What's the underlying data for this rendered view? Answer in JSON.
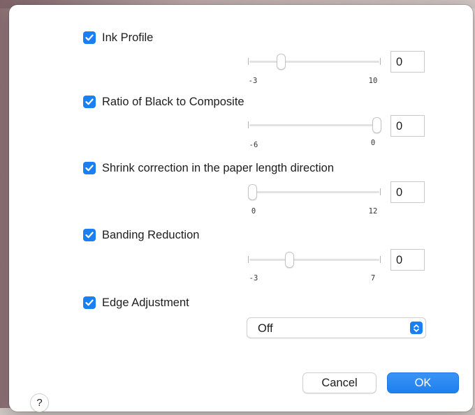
{
  "colors": {
    "accent": "#1a7ff0",
    "dialog_background": "#ffffff",
    "text": "#1d1d1f"
  },
  "options": [
    {
      "label": "Ink Profile",
      "checked": true,
      "control": "slider",
      "min_label": "-3",
      "max_label": "10",
      "min": -3,
      "max": 10,
      "value": 0,
      "value_text": "0"
    },
    {
      "label": "Ratio of Black to Composite",
      "checked": true,
      "control": "slider",
      "min_label": "-6",
      "max_label": "0",
      "min": -6,
      "max": 0,
      "value": 0,
      "value_text": "0"
    },
    {
      "label": "Shrink correction in the paper length direction",
      "checked": true,
      "control": "slider",
      "min_label": "0",
      "max_label": "12",
      "min": 0,
      "max": 12,
      "value": 0,
      "value_text": "0"
    },
    {
      "label": "Banding Reduction",
      "checked": true,
      "control": "slider",
      "min_label": "-3",
      "max_label": "7",
      "min": -3,
      "max": 7,
      "value": 0,
      "value_text": "0"
    },
    {
      "label": "Edge Adjustment",
      "checked": true,
      "control": "select",
      "selected": "Off",
      "stepper_icon": "chevron-up-down-icon"
    }
  ],
  "footer": {
    "help_label": "?",
    "help_icon": "question-mark-icon",
    "cancel_label": "Cancel",
    "ok_label": "OK"
  },
  "checkbox_icon": "checkmark-icon"
}
